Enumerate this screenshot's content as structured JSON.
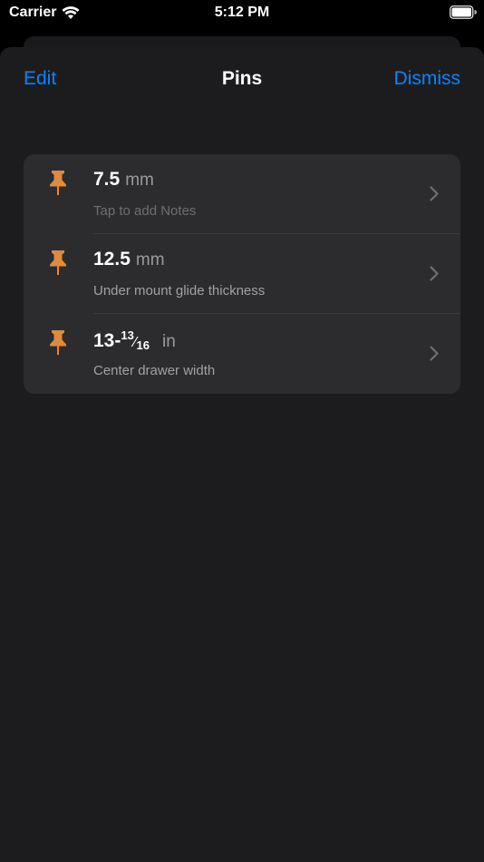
{
  "status_bar": {
    "carrier": "Carrier",
    "time": "5:12 PM",
    "icons": [
      "wifi-icon",
      "battery-icon"
    ]
  },
  "nav": {
    "edit_label": "Edit",
    "title": "Pins",
    "dismiss_label": "Dismiss"
  },
  "pins": [
    {
      "value": "7.5",
      "unit": "mm",
      "note": "Tap to add Notes"
    },
    {
      "value": "12.5",
      "unit": "mm",
      "note": "Under mount glide thickness"
    },
    {
      "value_whole": "13-",
      "fraction_numerator": "13",
      "fraction_denominator": "16",
      "unit": "in",
      "note": "Center drawer width"
    }
  ],
  "colors": {
    "accent": "#0a84ff",
    "pin": "#e08a3c",
    "background": "#1c1c1e",
    "cell": "#2c2c2e"
  },
  "icon_names": [
    "pushpin-icon",
    "chevron-right-icon"
  ]
}
